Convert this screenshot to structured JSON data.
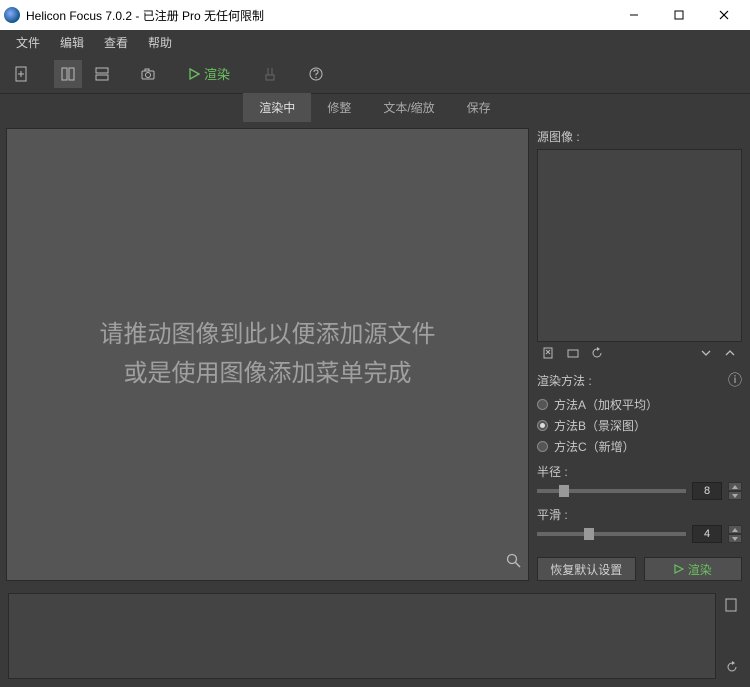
{
  "titlebar": {
    "text": "Helicon Focus 7.0.2 - 已注册 Pro 无任何限制"
  },
  "menu": {
    "file": "文件",
    "edit": "编辑",
    "view": "查看",
    "help": "帮助"
  },
  "toolbar": {
    "render": "渲染"
  },
  "tabs": {
    "rendering": "渲染中",
    "retouch": "修整",
    "text_scale": "文本/缩放",
    "save": "保存"
  },
  "canvas": {
    "drop_line1": "请推动图像到此以便添加源文件",
    "drop_line2": "或是使用图像添加菜单完成"
  },
  "panel": {
    "source_label": "源图像 :",
    "method_label": "渲染方法 :",
    "method_a": "方法A（加权平均）",
    "method_b": "方法B（景深图）",
    "method_c": "方法C（新增）",
    "radius_label": "半径 :",
    "radius_value": "8",
    "smooth_label": "平滑 :",
    "smooth_value": "4",
    "reset": "恢复默认设置",
    "render": "渲染"
  }
}
